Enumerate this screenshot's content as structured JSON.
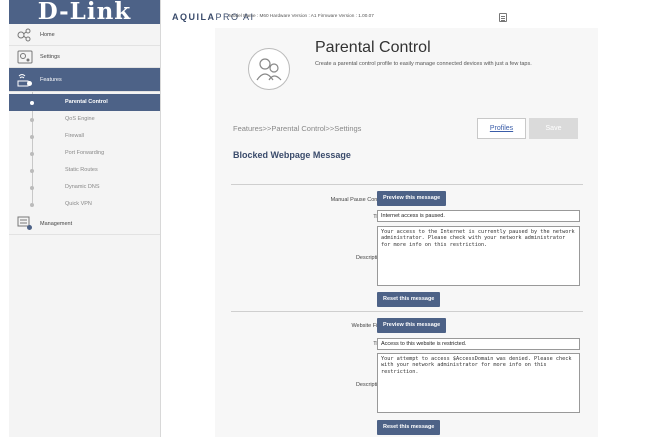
{
  "logo": {
    "text": "D-Link"
  },
  "header": {
    "brand_prefix": "AQUILA",
    "brand_suffix": "PRO AI",
    "hardware_info": "Model Name : M60 Hardware Version : A1 Firmware Version : 1.00.07",
    "doc_icon": "document-icon"
  },
  "sidebar": {
    "items": [
      {
        "label": "Home",
        "icon": "home-network-icon"
      },
      {
        "label": "Settings",
        "icon": "settings-icon"
      },
      {
        "label": "Features",
        "icon": "features-icon"
      },
      {
        "label": "Management",
        "icon": "management-icon"
      }
    ],
    "sub_items": [
      {
        "label": "Parental Control"
      },
      {
        "label": "QoS Engine"
      },
      {
        "label": "Firewall"
      },
      {
        "label": "Port Forwarding"
      },
      {
        "label": "Static Routes"
      },
      {
        "label": "Dynamic DNS"
      },
      {
        "label": "Quick VPN"
      }
    ]
  },
  "page": {
    "title": "Parental Control",
    "description": "Create a parental control profile to easily manage connected devices with just a few taps.",
    "breadcrumb": "Features>>Parental Control>>Settings",
    "profiles_label": "Profiles",
    "save_label": "Save",
    "section_title": "Blocked Webpage Message"
  },
  "manual_pause": {
    "label": "Manual Pause Control",
    "preview_label": "Preview this message",
    "title_label": "Title:",
    "title_value": "Internet access is paused.",
    "description_label": "Description:",
    "description_value": "Your access to the Internet is currently paused by the network administrator. Please check with your network administrator for more info on this restriction.",
    "reset_label": "Reset this message"
  },
  "website_filter": {
    "label": "Website Filter",
    "preview_label": "Preview this message",
    "title_label": "Title:",
    "title_value": "Access to this website is restricted.",
    "description_label": "Description:",
    "description_value": "Your attempt to access $AccessDomain was denied. Please check with your network administrator for more info on this restriction.",
    "reset_label": "Reset this message"
  },
  "colors": {
    "accent": "#4d6287",
    "link": "#3a5da8",
    "save_disabled": "#dadada"
  }
}
